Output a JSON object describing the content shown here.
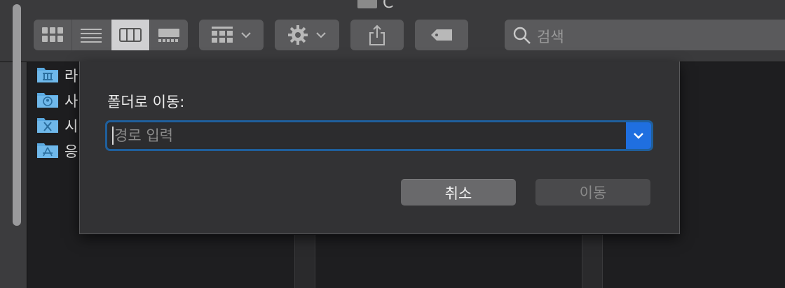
{
  "window": {
    "title_fragment": "C"
  },
  "toolbar": {
    "view_modes": [
      "icon-view",
      "list-view",
      "column-view",
      "gallery-view"
    ],
    "active_view": "column-view",
    "search_placeholder": "검색"
  },
  "sidebar": {
    "items": [
      {
        "label": "라",
        "icon": "library-folder-icon"
      },
      {
        "label": "사",
        "icon": "user-folder-icon"
      },
      {
        "label": "시",
        "icon": "system-folder-icon"
      },
      {
        "label": "응",
        "icon": "applications-folder-icon"
      }
    ]
  },
  "dialog": {
    "title": "폴더로 이동:",
    "path_placeholder": "경로 입력",
    "path_value": "",
    "cancel_label": "취소",
    "go_label": "이동"
  },
  "colors": {
    "accent": "#1f6fe0",
    "focus_ring": "#1f5f9c",
    "folder": "#5aa9e0"
  }
}
